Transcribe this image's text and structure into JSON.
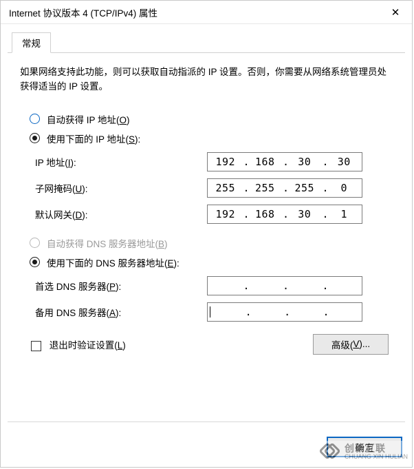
{
  "window": {
    "title": "Internet 协议版本 4 (TCP/IPv4) 属性",
    "close_symbol": "✕"
  },
  "tabs": {
    "general": "常规"
  },
  "description": "如果网络支持此功能，则可以获取自动指派的 IP 设置。否则，你需要从网络系统管理员处获得适当的 IP 设置。",
  "ip_section": {
    "radio_auto_label_pre": "自动获得 IP 地址(",
    "radio_auto_hotkey": "O",
    "radio_auto_label_post": ")",
    "radio_manual_label_pre": "使用下面的 IP 地址(",
    "radio_manual_hotkey": "S",
    "radio_manual_label_post": "):",
    "fields": {
      "ip_label_pre": "IP 地址(",
      "ip_hotkey": "I",
      "ip_label_post": "):",
      "ip_value": [
        "192",
        "168",
        "30",
        "30"
      ],
      "mask_label_pre": "子网掩码(",
      "mask_hotkey": "U",
      "mask_label_post": "):",
      "mask_value": [
        "255",
        "255",
        "255",
        "0"
      ],
      "gw_label_pre": "默认网关(",
      "gw_hotkey": "D",
      "gw_label_post": "):",
      "gw_value": [
        "192",
        "168",
        "30",
        "1"
      ]
    }
  },
  "dns_section": {
    "radio_auto_label_pre": "自动获得 DNS 服务器地址(",
    "radio_auto_hotkey": "B",
    "radio_auto_label_post": ")",
    "radio_manual_label_pre": "使用下面的 DNS 服务器地址(",
    "radio_manual_hotkey": "E",
    "radio_manual_label_post": "):",
    "fields": {
      "pref_label_pre": "首选 DNS 服务器(",
      "pref_hotkey": "P",
      "pref_label_post": "):",
      "pref_value": [
        "",
        "",
        "",
        ""
      ],
      "alt_label_pre": "备用 DNS 服务器(",
      "alt_hotkey": "A",
      "alt_label_post": "):",
      "alt_value": [
        "",
        "",
        "",
        ""
      ]
    }
  },
  "validate": {
    "label_pre": "退出时验证设置(",
    "hotkey": "L",
    "label_post": ")"
  },
  "buttons": {
    "advanced_pre": "高级(",
    "advanced_hotkey": "V",
    "advanced_post": ")...",
    "ok": "确定"
  },
  "watermark": {
    "brand": "创新互联",
    "sub": "CHUANG XIN HULIAN"
  }
}
